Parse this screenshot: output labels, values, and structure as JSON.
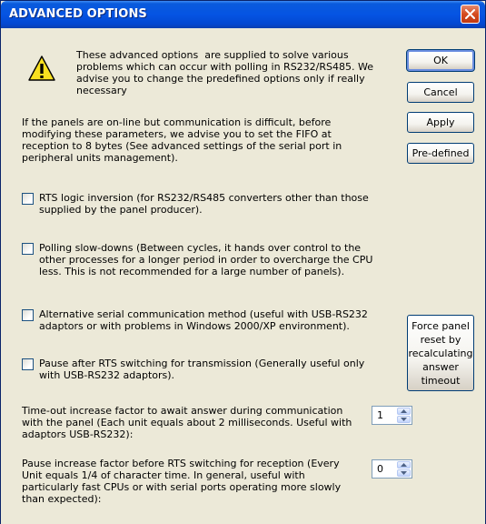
{
  "window": {
    "title": "ADVANCED OPTIONS"
  },
  "intro": [
    "These advanced options  are supplied to solve various",
    "problems which can occur with polling in RS232/RS485. We",
    "advise you to change the predefined options only if really",
    "necessary"
  ],
  "note": [
    "If the panels are on-line but communication is difficult, before",
    "modifying these parameters, we advise you to set the FIFO at",
    "reception to 8 bytes (See advanced settings of the serial port in",
    "peripheral units management)."
  ],
  "buttons": {
    "ok": "OK",
    "cancel": "Cancel",
    "apply": "Apply",
    "predefined": "Pre-defined",
    "force_reset": [
      "Force panel",
      "reset by",
      "recalculating",
      "answer",
      "timeout"
    ]
  },
  "options": {
    "rts_inversion": {
      "checked": false,
      "lines": [
        "RTS logic inversion (for RS232/RS485 converters other than those",
        "supplied by the panel producer)."
      ]
    },
    "polling_slowdowns": {
      "checked": false,
      "lines": [
        "Polling slow-downs (Between cycles, it hands over control to the",
        "other processes for a longer period in order to overcharge the CPU",
        "less. This is not recommended for a large number of panels)."
      ]
    },
    "alt_serial": {
      "checked": false,
      "lines": [
        "Alternative serial communication method (useful with USB-RS232",
        "adaptors or with problems in Windows 2000/XP environment)."
      ]
    },
    "pause_rts": {
      "checked": false,
      "lines": [
        "Pause after RTS switching for transmission (Generally useful only",
        "with USB-RS232 adaptors)."
      ]
    }
  },
  "fields": {
    "timeout_factor": {
      "lines": [
        "Time-out increase factor to await answer during communication",
        "with the panel (Each unit equals about 2 milliseconds. Useful with",
        "adaptors USB-RS232):"
      ],
      "value": "1"
    },
    "pause_factor": {
      "lines": [
        "Pause increase factor before RTS switching for reception (Every",
        "Unit equals 1/4 of character time. In general, useful with",
        "particularly fast CPUs or with serial ports operating more slowly",
        "than expected):"
      ],
      "value": "0"
    }
  }
}
